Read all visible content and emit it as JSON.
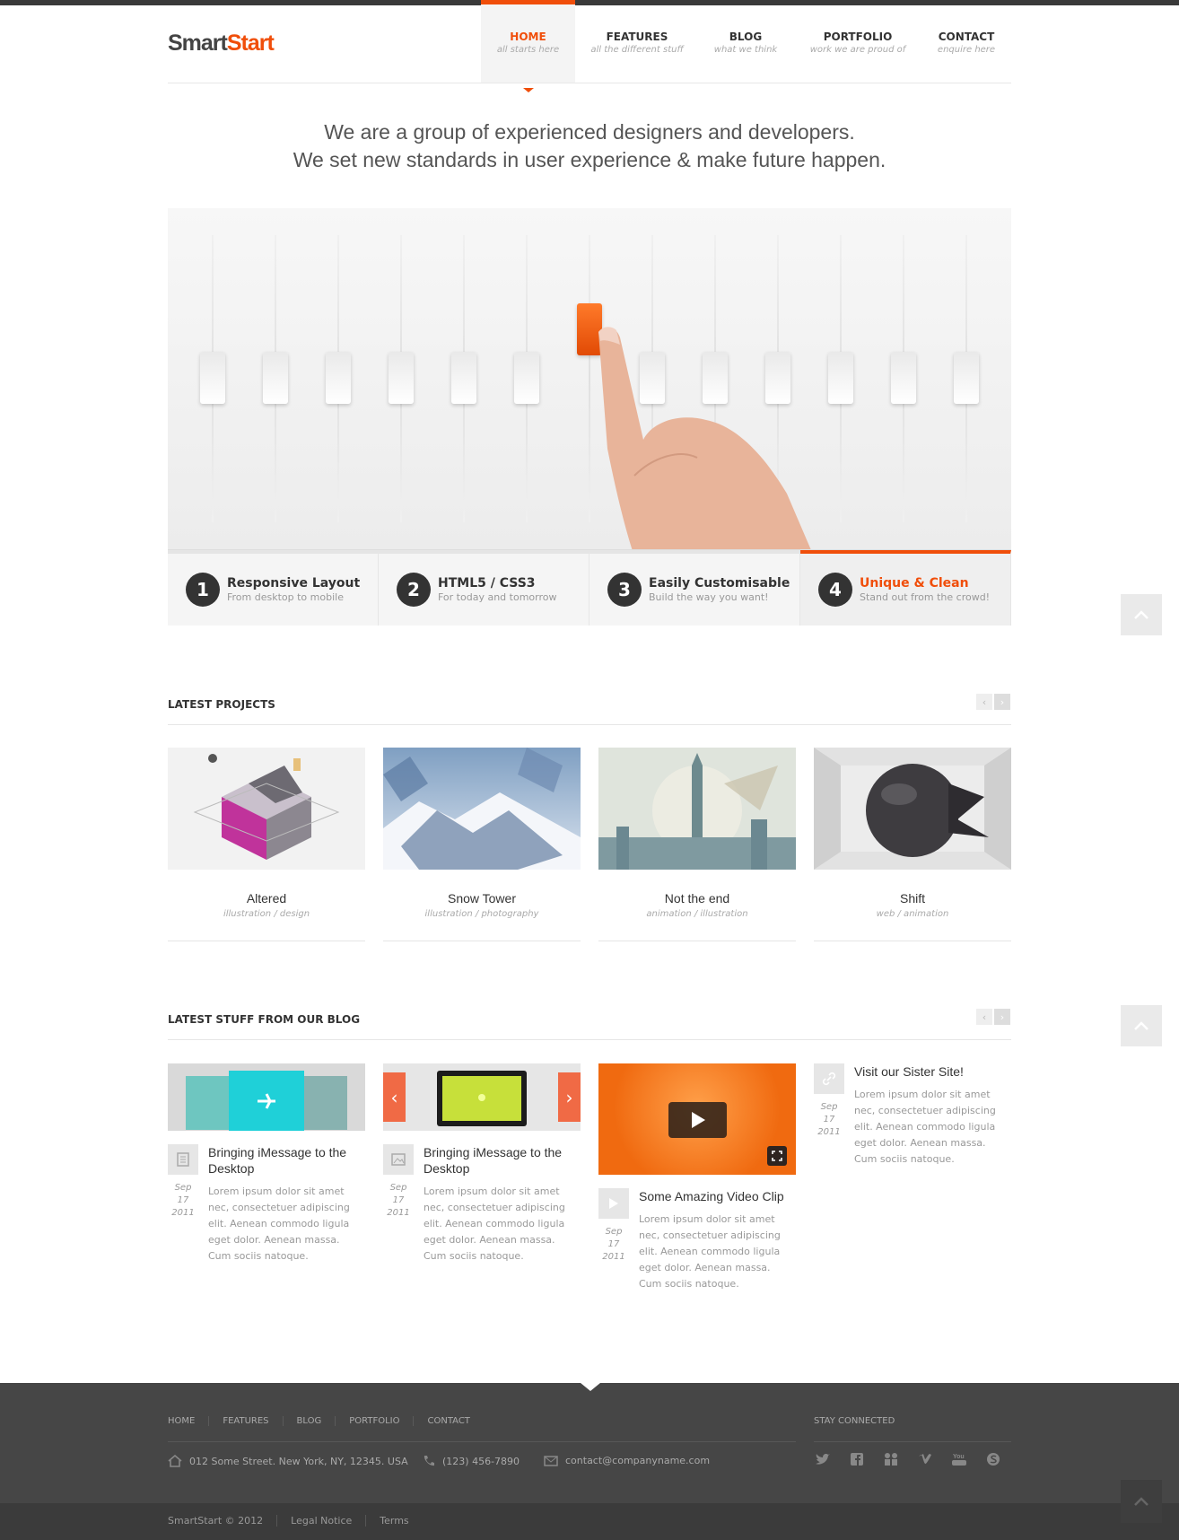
{
  "header": {
    "logo_part1": "Smart",
    "logo_part2": "Start",
    "nav": [
      {
        "label": "HOME",
        "sub": "all starts here"
      },
      {
        "label": "FEATURES",
        "sub": "all the different stuff"
      },
      {
        "label": "BLOG",
        "sub": "what we think"
      },
      {
        "label": "PORTFOLIO",
        "sub": "work we are proud of"
      },
      {
        "label": "CONTACT",
        "sub": "enquire here"
      }
    ]
  },
  "tagline": {
    "line1": "We are a group of experienced designers and developers.",
    "line2": "We set new standards in user experience & make future happen."
  },
  "features": [
    {
      "num": "1",
      "title": "Responsive Layout",
      "sub": "From desktop to mobile"
    },
    {
      "num": "2",
      "title": "HTML5 / CSS3",
      "sub": "For today and tomorrow"
    },
    {
      "num": "3",
      "title": "Easily Customisable",
      "sub": "Build the way you want!"
    },
    {
      "num": "4",
      "title": "Unique & Clean",
      "sub": "Stand out from the crowd!"
    }
  ],
  "projects": {
    "title": "LATEST PROJECTS",
    "items": [
      {
        "title": "Altered",
        "sub": "illustration / design"
      },
      {
        "title": "Snow Tower",
        "sub": "illustration / photography"
      },
      {
        "title": "Not the end",
        "sub": "animation / illustration"
      },
      {
        "title": "Shift",
        "sub": "web / animation"
      }
    ]
  },
  "blog": {
    "title": "LATEST STUFF FROM OUR BLOG",
    "posts": [
      {
        "title": "Bringing iMessage to the Desktop",
        "date1": "Sep 17",
        "date2": "2011",
        "text": "Lorem ipsum dolor sit amet nec, consectetuer adipiscing elit. Aenean commodo ligula eget dolor. Aenean massa. Cum sociis natoque."
      },
      {
        "title": "Bringing iMessage to the Desktop",
        "date1": "Sep 17",
        "date2": "2011",
        "text": "Lorem ipsum dolor sit amet nec, consectetuer adipiscing elit. Aenean commodo ligula eget dolor. Aenean massa. Cum sociis natoque."
      },
      {
        "title": "Some Amazing Video Clip",
        "date1": "Sep 17",
        "date2": "2011",
        "text": "Lorem ipsum dolor sit amet nec, consectetuer adipiscing elit. Aenean commodo ligula eget dolor. Aenean massa. Cum sociis natoque."
      },
      {
        "title": "Visit our Sister Site!",
        "date1": "Sep 17",
        "date2": "2011",
        "text": "Lorem ipsum dolor sit amet nec, consectetuer adipiscing elit. Aenean commodo ligula eget dolor. Aenean massa. Cum sociis natoque."
      }
    ]
  },
  "footer": {
    "nav": [
      "HOME",
      "FEATURES",
      "BLOG",
      "PORTFOLIO",
      "CONTACT"
    ],
    "address": "012 Some Street. New York, NY, 12345. USA",
    "phone": "(123) 456-7890",
    "email": "contact@companyname.com",
    "stay": "STAY CONNECTED",
    "social": [
      "twitter-icon",
      "facebook-icon",
      "flickr-icon",
      "vimeo-icon",
      "youtube-icon",
      "skype-icon"
    ],
    "copyright": "SmartStart © 2012",
    "legal": "Legal Notice",
    "terms": "Terms"
  },
  "colors": {
    "accent": "#f04e0a",
    "dark": "#333333",
    "footer": "#464646"
  },
  "icons": {
    "to_top": "chevron-up-icon",
    "prev": "chevron-left-icon",
    "next": "chevron-right-icon",
    "play": "play-icon",
    "fullscreen": "fullscreen-icon",
    "home": "home-icon",
    "phone": "phone-icon",
    "mail": "mail-icon",
    "document": "document-icon",
    "image": "image-icon",
    "link": "link-icon"
  }
}
